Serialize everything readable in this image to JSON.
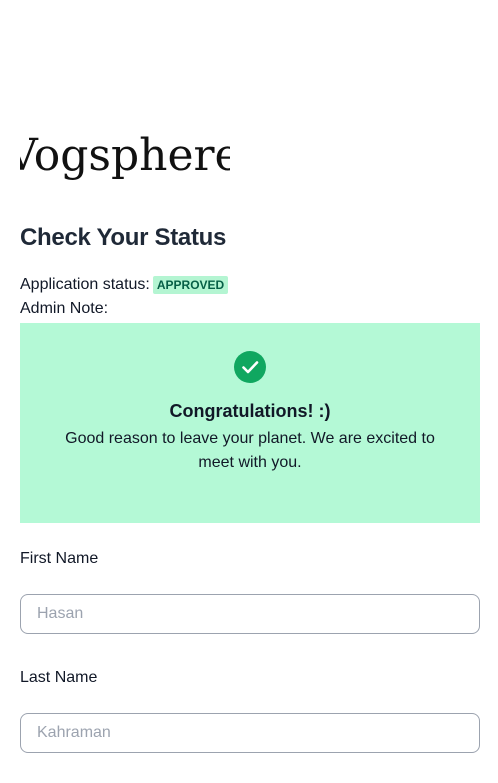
{
  "brand": {
    "logo_text": "Vogsphere"
  },
  "page": {
    "title": "Check Your Status"
  },
  "status": {
    "label": "Application status:",
    "badge": "APPROVED",
    "badge_color": "#b4f5d2"
  },
  "admin_note": {
    "label": "Admin Note:",
    "icon": "check-circle-icon",
    "title": "Congratulations! :)",
    "message": "Good reason to leave your planet. We are excited to meet with you.",
    "background_color": "#b4f9d6",
    "icon_color": "#10a760"
  },
  "form": {
    "first_name": {
      "label": "First Name",
      "placeholder": "Hasan"
    },
    "last_name": {
      "label": "Last Name",
      "placeholder": "Kahraman"
    }
  }
}
